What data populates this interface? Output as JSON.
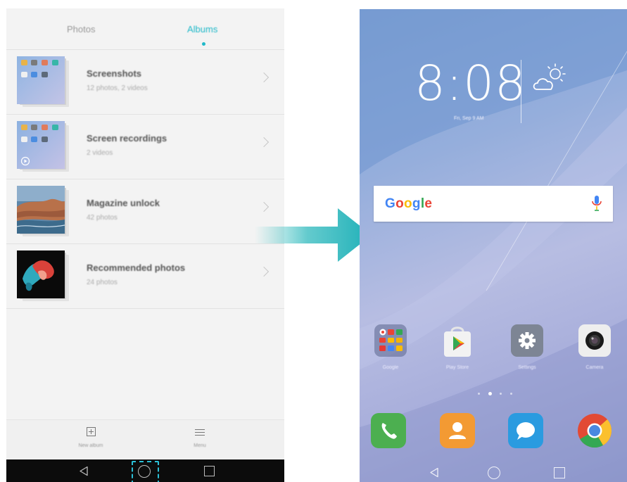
{
  "gallery": {
    "tabs": [
      {
        "label": "Photos"
      },
      {
        "label": "Albums",
        "active": true
      }
    ],
    "albums": [
      {
        "name": "Screenshots",
        "count": "12 photos, 2 videos"
      },
      {
        "name": "Screen recordings",
        "count": "2 videos"
      },
      {
        "name": "Magazine unlock",
        "count": "42 photos"
      },
      {
        "name": "Recommended photos",
        "count": "24 photos"
      }
    ],
    "bottom_bar": {
      "new_album": "New album",
      "menu": "Menu"
    }
  },
  "home": {
    "clock": "8:08",
    "date": "Fri, Sep 9 AM",
    "search": {
      "brand": "Google"
    },
    "apps": [
      {
        "label": "Google",
        "icon": "folder-icon"
      },
      {
        "label": "Play Store",
        "icon": "play-store-icon"
      },
      {
        "label": "Settings",
        "icon": "gear-icon"
      },
      {
        "label": "Camera",
        "icon": "camera-icon"
      }
    ],
    "dock": [
      {
        "icon": "phone-icon",
        "color": "#4caf50"
      },
      {
        "icon": "contacts-icon",
        "color": "#f39a33"
      },
      {
        "icon": "messages-icon",
        "color": "#2a9be0"
      },
      {
        "icon": "chrome-icon",
        "color": "#e24a34"
      }
    ],
    "page_indicator": {
      "pages": 4,
      "active": 2
    }
  },
  "colors": {
    "accent": "#21b9c9",
    "highlight": "#2bbfd6"
  }
}
